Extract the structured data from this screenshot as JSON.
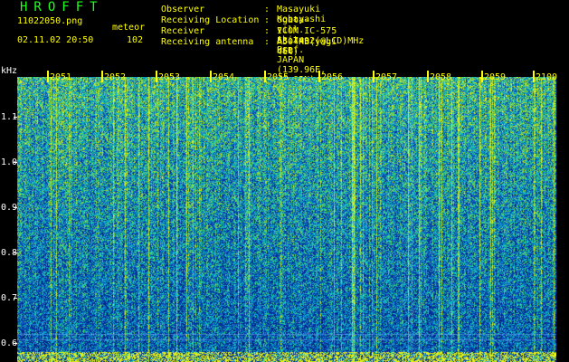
{
  "logo": "HROFFT",
  "file_name": "11022050.png",
  "event_label": "meteor",
  "date_time": "02.11.02 20:50",
  "count": "102",
  "header": [
    {
      "key": "Observer",
      "value": "Masayuki Kobayashi"
    },
    {
      "key": "Receiving Location",
      "value": "Ogata-vill. Akita-Pref. JAPAN (139.96E, 40.02N)"
    },
    {
      "key": "Receiver",
      "value": "ICOM IC-575 53.7492(@LCD)MHz USB"
    },
    {
      "key": "Receiving antenna",
      "value": "A504HB(yagi 4el)"
    }
  ],
  "separator": ":",
  "time_axis": [
    "2051",
    "2052",
    "2053",
    "2054",
    "2055",
    "2056",
    "2057",
    "2058",
    "2059",
    "2100"
  ],
  "freq_unit": "kHz",
  "freq_axis": [
    "1.1",
    "1.0",
    "0.9",
    "0.8",
    "0.7",
    "0.6"
  ],
  "colors": {
    "logo": "#22ff22",
    "text": "#ffff00",
    "axis": "#ffffff",
    "spectrum_base": "#1030a0"
  }
}
